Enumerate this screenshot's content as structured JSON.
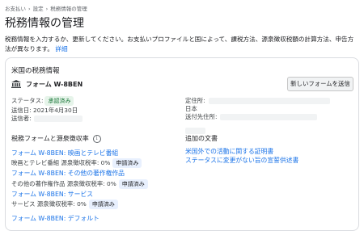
{
  "breadcrumb": {
    "items": [
      "お支払い",
      "設定",
      "税務情報の管理"
    ],
    "separator": "›"
  },
  "page": {
    "title": "税務情報の管理",
    "description": "税務情報を入力するか、更新してください。お支払いプロファイルと国によって、課税方法、源泉徴収税額の計算方法、申告方法が異なります。",
    "details_link": "詳細"
  },
  "card": {
    "title": "米国の税務情報",
    "form_icon": "bank-icon",
    "form_name": "フォーム W-8BEN",
    "send_button": "新しいフォームを送信",
    "status_label": "ステータス:",
    "status_value": "承認済み",
    "sent_date": "送信日: 2021年4月30日",
    "sender_label": "送信者:",
    "residence_label": "定住所:",
    "country": "日本",
    "mailing_label": "送付先住所:"
  },
  "withholding": {
    "title": "税務フォームと源泉徴収率",
    "info_icon": "info-icon",
    "forms": [
      {
        "link": "フォーム W-8BEN: 映画とテレビ番組",
        "rate": "映画とテレビ番組 源泉徴収税率: 0%",
        "badge": "申請済み"
      },
      {
        "link": "フォーム W-8BEN: その他の著作権作品",
        "rate": "その他の著作権作品 源泉徴収税率: 0%",
        "badge": "申請済み"
      },
      {
        "link": "フォーム W-8BEN: サービス",
        "rate": "サービス 源泉徴収税率: 0%",
        "badge": "申請済み"
      },
      {
        "link": "フォーム W-8BEN: デフォルト",
        "rate": "",
        "badge": ""
      }
    ]
  },
  "additional": {
    "title": "追加の文書",
    "links": [
      "米国外での活動に関する証明書",
      "ステータスに変更がない旨の宣誓供述書"
    ]
  },
  "colors": {
    "link": "#1a73e8",
    "approved_bg": "#e6f4ea",
    "approved_text": "#137333",
    "border": "#dadce0"
  }
}
